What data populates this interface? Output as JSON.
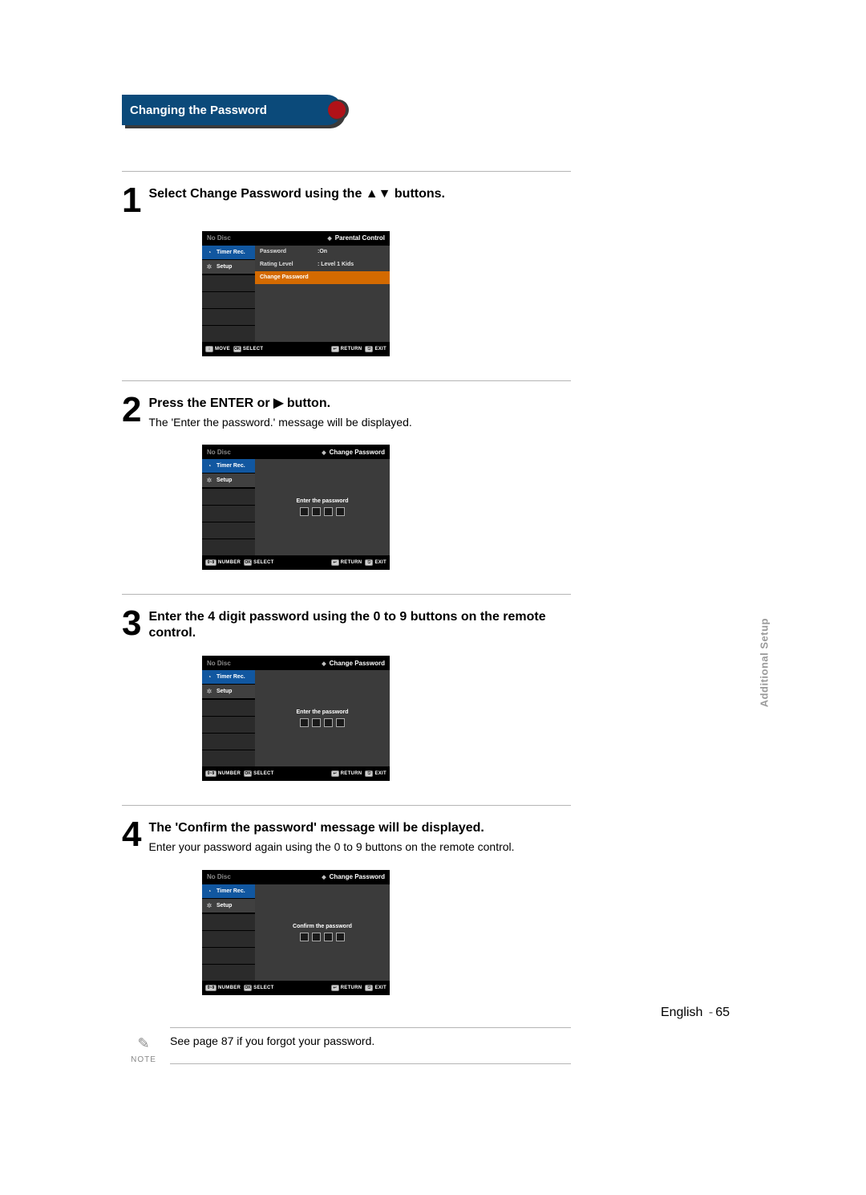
{
  "side_tab": "Additional Setup",
  "heading": "Changing the Password",
  "footer": {
    "lang": "English",
    "sep": "-",
    "num": "65"
  },
  "note": {
    "icon_label": "NOTE",
    "text": "See page 87 if you forgot your password."
  },
  "osd_common": {
    "no_disc": "No Disc",
    "side_timer": "Timer Rec.",
    "side_setup": "Setup",
    "ft_move": "MOVE",
    "ft_number": "NUMBER",
    "ft_select": "SELECT",
    "ft_return": "RETURN",
    "ft_exit": "EXIT",
    "ft_ok": "OK",
    "ft_arrows": "↕",
    "ft_return_glyph": "↩",
    "ft_exit_glyph": "⎋",
    "ft_num_glyph": "0~9"
  },
  "steps": [
    {
      "num": "1",
      "title_pre": "Select ",
      "title_bold2": "Change Password",
      "title_mid": " using the ",
      "title_arrows": "▲▼",
      "title_tail": " buttons.",
      "body": "",
      "osd": {
        "crumb": "Parental Control",
        "rows": [
          {
            "k": "Password",
            "v": ":On",
            "hl": false
          },
          {
            "k": "Rating Level",
            "v": ": Level 1 Kids",
            "hl": false
          },
          {
            "k": "Change Password",
            "v": "",
            "hl": true
          }
        ],
        "footer_left": "move"
      }
    },
    {
      "num": "2",
      "title_pre": "Press the ",
      "title_bold2": "ENTER",
      "title_mid": " or ",
      "title_arrows": "▶",
      "title_tail": " button.",
      "body": "The 'Enter the password.' message will be displayed.",
      "osd": {
        "crumb": "Change Password",
        "center_text": "Enter the password",
        "footer_left": "number"
      }
    },
    {
      "num": "3",
      "title_pre": "Enter the 4 digit password using the 0 to 9 buttons on the remote control.",
      "title_bold2": "",
      "title_mid": "",
      "title_arrows": "",
      "title_tail": "",
      "body": "",
      "osd": {
        "crumb": "Change Password",
        "center_text": "Enter the password",
        "footer_left": "number"
      }
    },
    {
      "num": "4",
      "title_pre": "The 'Confirm the password' message will be displayed.",
      "title_bold2": "",
      "title_mid": "",
      "title_arrows": "",
      "title_tail": "",
      "body": "Enter your password again using the 0 to 9 buttons on the remote control.",
      "osd": {
        "crumb": "Change Password",
        "center_text": "Confirm the password",
        "footer_left": "number"
      }
    }
  ]
}
